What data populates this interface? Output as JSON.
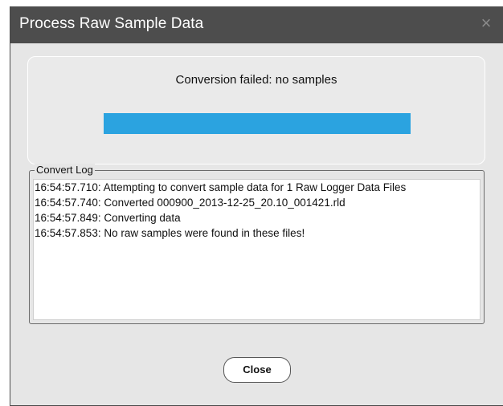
{
  "window": {
    "title": "Process Raw Sample Data",
    "close_icon": "close-icon"
  },
  "status": {
    "message": "Conversion failed: no samples",
    "progress_fraction": 1.0,
    "progress_color": "#2ba3e0"
  },
  "log": {
    "legend": "Convert Log",
    "lines": [
      "16:54:57.710: Attempting to convert sample data for 1 Raw Logger Data Files",
      "16:54:57.740: Converted 000900_2013-12-25_20.10_001421.rld",
      "16:54:57.849: Converting data",
      "16:54:57.853: No raw samples were found in these files!"
    ]
  },
  "buttons": {
    "close_label": "Close"
  },
  "colors": {
    "titlebar": "#4d4d4d",
    "dialog_background": "#e6e6e6",
    "accent": "#2ba3e0"
  }
}
